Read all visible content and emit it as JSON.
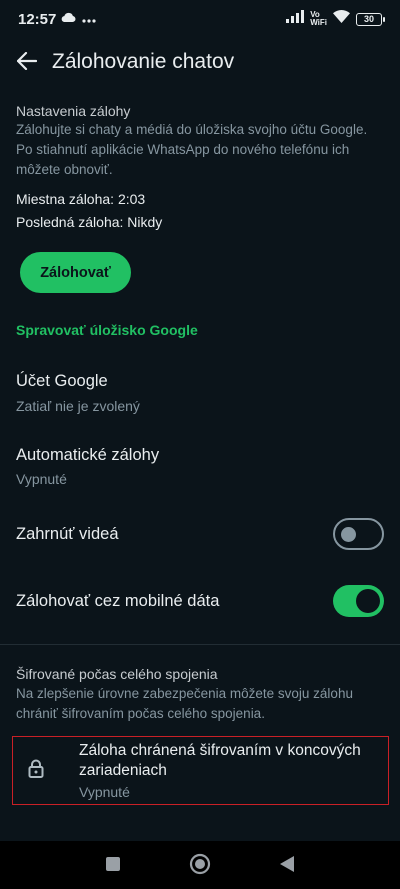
{
  "status_bar": {
    "time": "12:57",
    "left_icons": [
      "cloud-icon",
      "more-dots-icon"
    ],
    "volte_line1": "Vo",
    "volte_line2": "WiFi",
    "battery": "30"
  },
  "app_bar": {
    "title": "Zálohovanie chatov",
    "back_icon": "arrow-left-icon"
  },
  "backup_settings": {
    "title": "Nastavenia zálohy",
    "description": "Zálohujte si chaty a médiá do úložiska svojho účtu Google. Po stiahnutí aplikácie WhatsApp do nového telefónu ich môžete obnoviť.",
    "local_backup": "Miestna záloha: 2:03",
    "last_backup": "Posledná záloha: Nikdy",
    "backup_button": "Zálohovať",
    "manage_link": "Spravovať úložisko Google"
  },
  "settings": {
    "google_account_label": "Účet Google",
    "google_account_value": "Zatiaľ nie je zvolený",
    "auto_backup_label": "Automatické zálohy",
    "auto_backup_value": "Vypnuté",
    "include_videos_label": "Zahrnúť videá",
    "include_videos_on": false,
    "mobile_data_label": "Zálohovať cez mobilné dáta",
    "mobile_data_on": true
  },
  "e2e": {
    "title": "Šifrované počas celého spojenia",
    "description": "Na zlepšenie úrovne zabezpečenia môžete svoju zálohu chrániť šifrovaním počas celého spojenia.",
    "item_title": "Záloha chránená šifrovaním v koncových zariadeniach",
    "item_value": "Vypnuté",
    "item_icon": "lock-icon"
  },
  "nav": {
    "icons": [
      "recents-square-icon",
      "home-circle-icon",
      "back-triangle-icon"
    ]
  },
  "colors": {
    "background": "#0b141a",
    "accent": "#21c063",
    "highlight_border": "#c92026"
  }
}
